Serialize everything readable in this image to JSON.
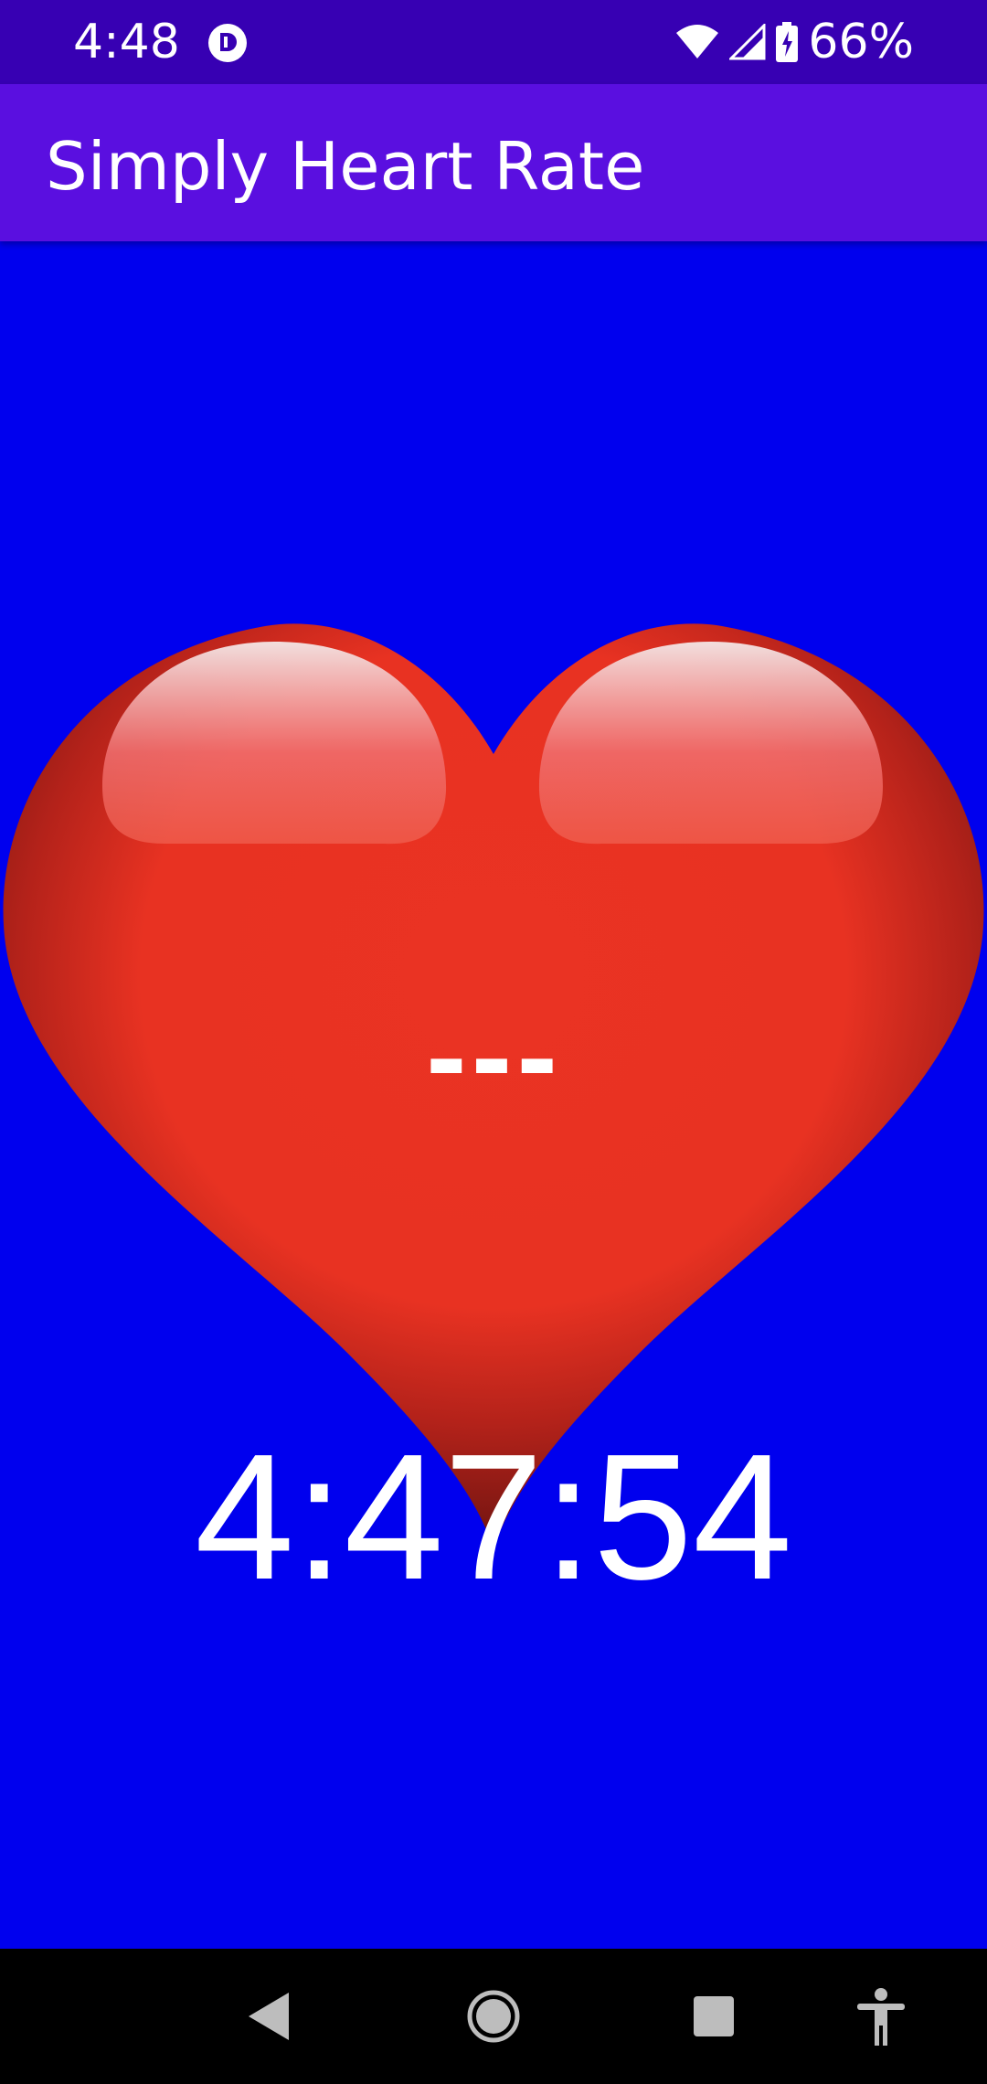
{
  "status_bar": {
    "time": "4:48",
    "battery_percent": "66%",
    "icons": [
      "app-notification-icon",
      "wifi-icon",
      "cell-signal-icon",
      "battery-charging-icon"
    ]
  },
  "app_bar": {
    "title": "Simply Heart Rate"
  },
  "main": {
    "heart_rate": "---",
    "clock": "4:47:54"
  },
  "nav_bar": {
    "icons": [
      "back-icon",
      "home-icon",
      "recents-icon",
      "accessibility-icon"
    ]
  },
  "colors": {
    "background": "#0000ee",
    "status_bar": "#3700b3",
    "app_bar": "#5a0fe0",
    "heart": "#e8321f",
    "text": "#ffffff"
  }
}
